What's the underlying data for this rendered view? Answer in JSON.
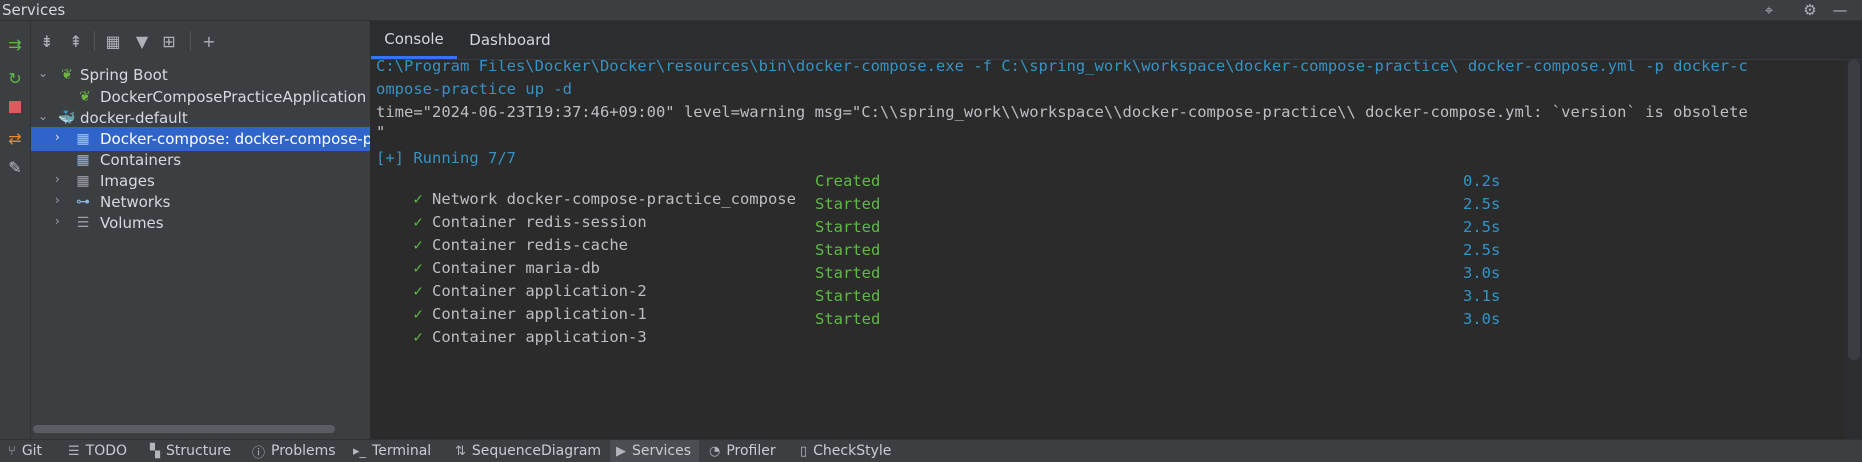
{
  "window": {
    "title": "Services"
  },
  "titlebar_icons": [
    "target-icon",
    "gear-icon",
    "minimize-icon"
  ],
  "tabs": [
    {
      "label": "Console",
      "active": true
    },
    {
      "label": "Dashboard",
      "active": false
    }
  ],
  "tree": {
    "items": [
      {
        "label": "Spring Boot",
        "icon": "spring-boot-icon",
        "expanded": true
      },
      {
        "label": "DockerComposePracticeApplication",
        "icon": "spring-app-icon"
      },
      {
        "label": "docker-default",
        "icon": "docker-icon",
        "expanded": true
      },
      {
        "label": "Docker-compose: docker-compose-pra",
        "icon": "compose-icon",
        "selected": true
      },
      {
        "label": "Containers",
        "icon": "containers-icon"
      },
      {
        "label": "Images",
        "icon": "images-icon"
      },
      {
        "label": "Networks",
        "icon": "networks-icon"
      },
      {
        "label": "Volumes",
        "icon": "volumes-icon"
      }
    ]
  },
  "console": {
    "command_line_1": "C:\\Program Files\\Docker\\Docker\\resources\\bin\\docker-compose.exe -f C:\\spring_work\\workspace\\docker-compose-practice\\ docker-compose.yml -p docker-c",
    "command_line_2": "ompose-practice up -d",
    "warning_line_1": "time=\"2024-06-23T19:37:46+09:00\" level=warning msg=\"C:\\\\spring_work\\\\workspace\\\\docker-compose-practice\\\\ docker-compose.yml: `version` is obsolete",
    "warning_line_2": "\"",
    "running": "[+] Running 7/7",
    "checkmark": "✓",
    "rows": [
      {
        "name": "Network docker-compose-practice_compose",
        "status": "Created",
        "duration": "0.2s"
      },
      {
        "name": "Container redis-session",
        "status": "Started",
        "duration": "2.5s"
      },
      {
        "name": "Container redis-cache",
        "status": "Started",
        "duration": "2.5s"
      },
      {
        "name": "Container maria-db",
        "status": "Started",
        "duration": "2.5s"
      },
      {
        "name": "Container application-2",
        "status": "Started",
        "duration": "3.0s"
      },
      {
        "name": "Container application-1",
        "status": "Started",
        "duration": "3.1s"
      },
      {
        "name": "Container application-3",
        "status": "Started",
        "duration": "3.0s"
      }
    ]
  },
  "bottom_bar": {
    "items": [
      {
        "label": "Git",
        "icon": "git-icon"
      },
      {
        "label": "TODO",
        "icon": "todo-icon"
      },
      {
        "label": "Structure",
        "icon": "structure-icon"
      },
      {
        "label": "Problems",
        "icon": "problems-icon"
      },
      {
        "label": "Terminal",
        "icon": "terminal-icon"
      },
      {
        "label": "SequenceDiagram",
        "icon": "sequence-diagram-icon"
      },
      {
        "label": "Services",
        "icon": "services-icon",
        "active": true
      },
      {
        "label": "Profiler",
        "icon": "profiler-icon"
      },
      {
        "label": "CheckStyle",
        "icon": "checkstyle-icon"
      }
    ]
  },
  "colors": {
    "selection": "#2f65ca",
    "command": "#3592c4",
    "success": "#5fb946",
    "tab_underline": "#3574f0"
  }
}
